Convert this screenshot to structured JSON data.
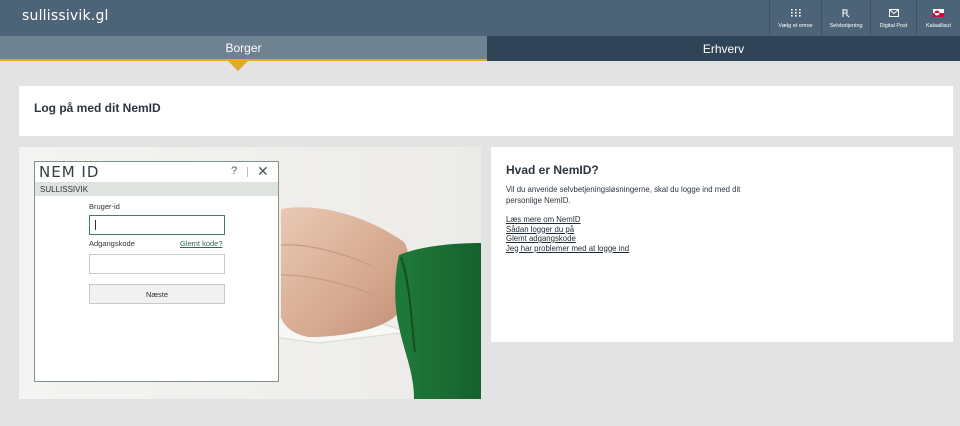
{
  "header": {
    "logo": "sullissivik.gl",
    "tools": [
      {
        "label": "Vælg et emne",
        "icon": "grid-icon"
      },
      {
        "label": "Selvbetjening",
        "icon": "selfservice-icon"
      },
      {
        "label": "Digital Post",
        "icon": "mail-icon"
      },
      {
        "label": "Kalaallisut",
        "icon": "greenland-flag-icon"
      }
    ]
  },
  "nav": {
    "tabs": [
      {
        "label": "Borger",
        "active": true
      },
      {
        "label": "Erhverv",
        "active": false
      }
    ],
    "accent": "#e3a92f"
  },
  "page": {
    "title": "Log på med dit NemID"
  },
  "nemid": {
    "logo": "NEM ID",
    "help": "?",
    "close": "✕",
    "service": "SULLISSIVIK",
    "user_label": "Bruger-id",
    "user_value": "",
    "password_label": "Adgangskode",
    "password_value": "",
    "forgot_label": "Glemt kode?",
    "next_label": "Næste"
  },
  "info": {
    "title": "Hvad er NemID?",
    "text": "Vil du anvende selvbetjeningsløsningerne, skal du logge ind med dit personlige NemID.",
    "links": [
      "Læs mere om NemID",
      "Sådan logger du på",
      "Glemt adgangskode",
      "Jeg har problemer med at logge ind"
    ]
  },
  "colors": {
    "topbar": "#4d6478",
    "tab_active": "#6f8291",
    "tab_inactive": "#2f4456",
    "nemid_green": "#3f7d6b",
    "sleeve": "#1f7a3a"
  }
}
